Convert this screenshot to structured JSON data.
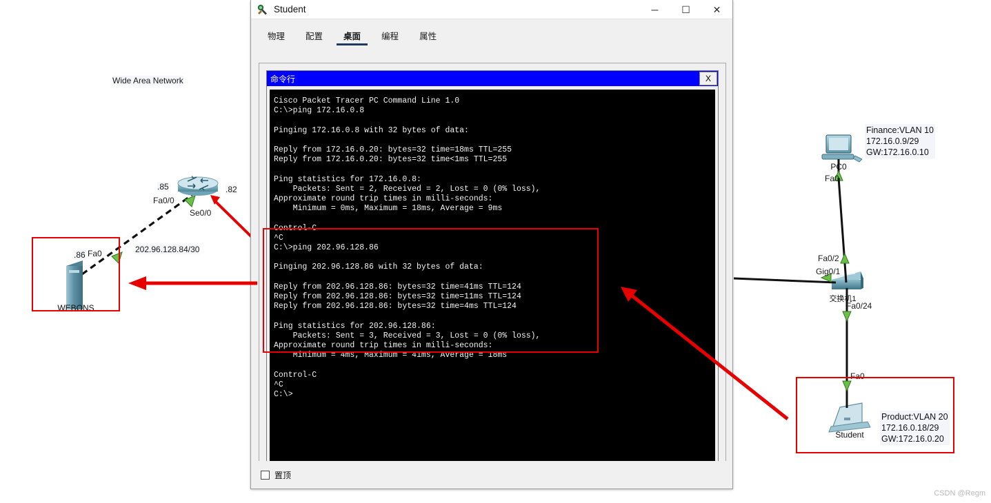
{
  "window": {
    "title": "Student",
    "icon": "packet-tracer-icon",
    "controls": {
      "minimize": "─",
      "maximize": "☐",
      "close": "✕"
    },
    "tabs": [
      {
        "label": "物理",
        "active": false
      },
      {
        "label": "配置",
        "active": false
      },
      {
        "label": "桌面",
        "active": true
      },
      {
        "label": "编程",
        "active": false
      },
      {
        "label": "属性",
        "active": false
      }
    ],
    "inner_window": {
      "title": "命令行",
      "close_label": "X"
    },
    "always_on_top": {
      "label": "置顶",
      "checked": false
    }
  },
  "terminal": {
    "text": "Cisco Packet Tracer PC Command Line 1.0\nC:\\>ping 172.16.0.8\n\nPinging 172.16.0.8 with 32 bytes of data:\n\nReply from 172.16.0.20: bytes=32 time=18ms TTL=255\nReply from 172.16.0.20: bytes=32 time<1ms TTL=255\n\nPing statistics for 172.16.0.8:\n    Packets: Sent = 2, Received = 2, Lost = 0 (0% loss),\nApproximate round trip times in milli-seconds:\n    Minimum = 0ms, Maximum = 18ms, Average = 9ms\n\nControl-C\n^C\nC:\\>ping 202.96.128.86\n\nPinging 202.96.128.86 with 32 bytes of data:\n\nReply from 202.96.128.86: bytes=32 time=41ms TTL=124\nReply from 202.96.128.86: bytes=32 time=11ms TTL=124\nReply from 202.96.128.86: bytes=32 time=4ms TTL=124\n\nPing statistics for 202.96.128.86:\n    Packets: Sent = 3, Received = 3, Lost = 0 (0% loss),\nApproximate round trip times in milli-seconds:\n    Minimum = 4ms, Maximum = 41ms, Average = 18ms\n\nControl-C\n^C\nC:\\>"
  },
  "topology": {
    "wan_label": "Wide Area Network",
    "link_label": "202.96.128.84/30",
    "devices": {
      "router": {
        "name": "",
        "port_left": "Fa0/0",
        "port_right": "Se0/0",
        "ip_left": ".85",
        "ip_right": ".82"
      },
      "server": {
        "name": "WEBONS",
        "port": "Fa0",
        "ip": ".86"
      },
      "pc0": {
        "name": "PC0",
        "port": "Fa0"
      },
      "switch": {
        "name": "交换机1",
        "port_uplink": "Gig0/1",
        "port_pc0": "Fa0/2",
        "port_student": "Fa0/24"
      },
      "student": {
        "name": "Student",
        "port": "Fa0"
      }
    },
    "tooltips": {
      "finance": "Finance:VLAN 10\n172.16.0.9/29\nGW:172.16.0.10",
      "finance_lines": [
        "Finance:VLAN 10",
        "172.16.0.9/29",
        "GW:172.16.0.10"
      ],
      "product_lines": [
        "Product:VLAN 20",
        "172.16.0.18/29",
        "GW:172.16.0.20"
      ]
    }
  },
  "annotations": {
    "highlight_color": "#e60000",
    "boxes": [
      "server-highlight-box",
      "terminal-highlight-box",
      "student-highlight-box"
    ],
    "arrows": [
      "arrow-to-server",
      "arrow-to-student"
    ]
  },
  "watermark": "CSDN @Regm"
}
